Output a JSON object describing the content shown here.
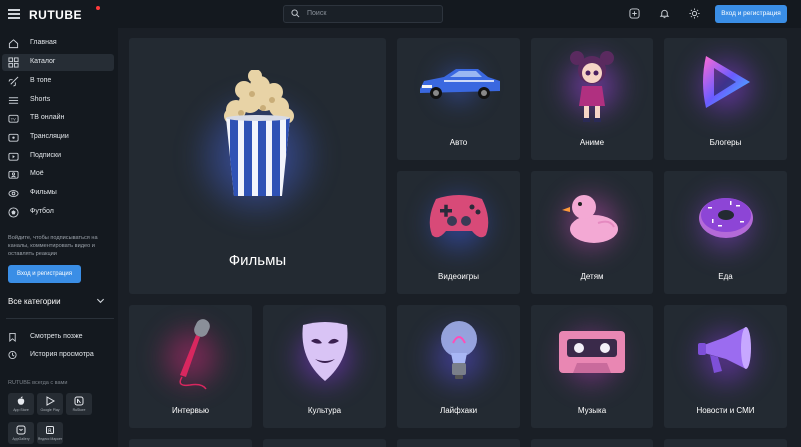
{
  "header": {
    "logo": "RUTUBE",
    "search_placeholder": "Поиск",
    "login_button": "Вход и регистрация",
    "icons": [
      "menu-icon",
      "search-icon",
      "upload-icon",
      "bell-icon",
      "theme-icon"
    ]
  },
  "sidebar": {
    "items": [
      {
        "label": "Главная",
        "icon": "home-icon"
      },
      {
        "label": "Каталог",
        "icon": "catalog-icon",
        "active": true
      },
      {
        "label": "В топе",
        "icon": "rocket-icon"
      },
      {
        "label": "Shorts",
        "icon": "shorts-icon"
      },
      {
        "label": "ТВ онлайн",
        "icon": "tv-icon"
      },
      {
        "label": "Трансляции",
        "icon": "broadcast-icon"
      },
      {
        "label": "Подписки",
        "icon": "subscriptions-icon"
      },
      {
        "label": "Моё",
        "icon": "my-icon"
      },
      {
        "label": "Фильмы",
        "icon": "films-icon"
      },
      {
        "label": "Футбол",
        "icon": "football-icon"
      }
    ],
    "promo_text": "Войдите, чтобы подписываться на каналы, комментировать видео и оставлять реакции",
    "login_button": "Вход и регистрация",
    "all_categories": "Все категории",
    "watch_later": "Смотреть позже",
    "history": "История просмотра",
    "apps_title": "RUTUBE всегда с вами",
    "apps": [
      {
        "label": "App Store",
        "icon": "apple-icon"
      },
      {
        "label": "Google Play",
        "icon": "google-play-icon"
      },
      {
        "label": "RuStore",
        "icon": "rustore-icon"
      },
      {
        "label": "AppGallery",
        "icon": "appgallery-icon"
      },
      {
        "label": "Яндекс Маркет",
        "icon": "store-icon"
      }
    ]
  },
  "catalog": {
    "big_card": "Фильмы",
    "cards": [
      "Авто",
      "Аниме",
      "Блогеры",
      "Видеоигры",
      "Детям",
      "Еда",
      "Интервью",
      "Культура",
      "Лайфхаки",
      "Музыка",
      "Новости и СМИ"
    ]
  },
  "colors": {
    "accent": "#3a8ee6",
    "background": "#14191f",
    "card": "#232a32"
  }
}
